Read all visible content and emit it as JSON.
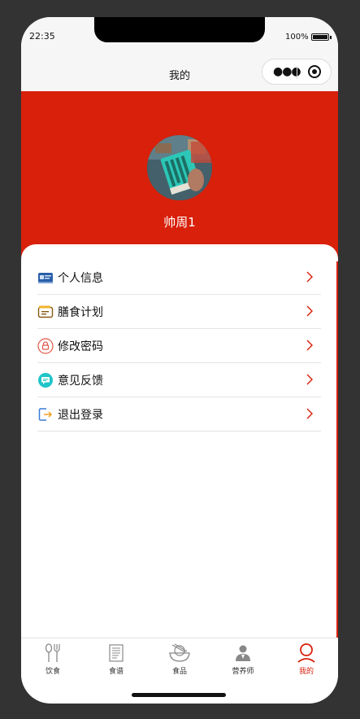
{
  "status_bar": {
    "time": "22:35",
    "battery_percent": "100%"
  },
  "nav_bar": {
    "title": "我的",
    "capsule_icons": [
      "more-dots-icon",
      "close-target-icon"
    ]
  },
  "profile": {
    "username": "帅周1",
    "header_color": "#d8200b"
  },
  "menu": {
    "items": [
      {
        "label": "个人信息",
        "icon": "id-card-icon"
      },
      {
        "label": "膳食计划",
        "icon": "wallet-icon"
      },
      {
        "label": "修改密码",
        "icon": "lock-icon"
      },
      {
        "label": "意见反馈",
        "icon": "chat-bubble-icon"
      },
      {
        "label": "退出登录",
        "icon": "logout-icon"
      }
    ],
    "arrow_color": "#d8200b"
  },
  "tabbar": {
    "items": [
      {
        "label": "饮食",
        "icon": "fork-spoon-icon",
        "active": false
      },
      {
        "label": "食谱",
        "icon": "recipe-book-icon",
        "active": false
      },
      {
        "label": "食品",
        "icon": "bowl-icon",
        "active": false
      },
      {
        "label": "营养师",
        "icon": "nutritionist-icon",
        "active": false
      },
      {
        "label": "我的",
        "icon": "user-icon",
        "active": true
      }
    ],
    "active_color": "#d8200b"
  }
}
